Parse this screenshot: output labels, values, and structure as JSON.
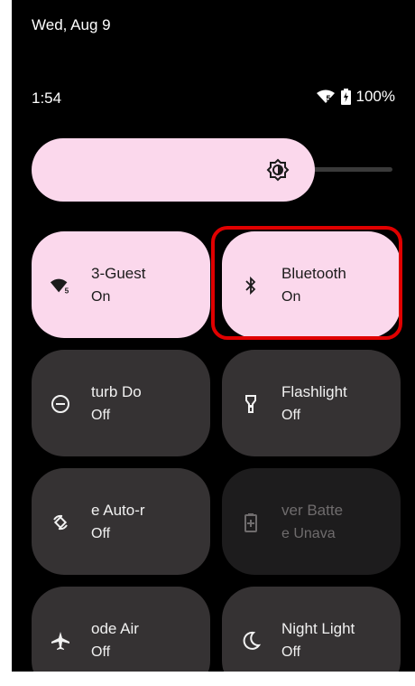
{
  "header": {
    "date": "Wed, Aug 9",
    "time": "1:54",
    "battery": "100%",
    "wifi_badge": "5"
  },
  "brightness": {
    "level": 0.82
  },
  "tiles": [
    {
      "label": "3-Guest",
      "status": "On",
      "icon": "wifi-icon",
      "state": "on"
    },
    {
      "label": "Bluetooth",
      "status": "On",
      "icon": "bluetooth-icon",
      "state": "on"
    },
    {
      "label": "turb Do",
      "status": "Off",
      "icon": "do-not-disturb-icon",
      "state": "off"
    },
    {
      "label": "Flashlight",
      "status": "Off",
      "icon": "flashlight-icon",
      "state": "off"
    },
    {
      "label": "e Auto-r",
      "status": "Off",
      "icon": "auto-rotate-icon",
      "state": "off"
    },
    {
      "label": "ver Batte",
      "status": "e Unava",
      "icon": "battery-saver-icon",
      "state": "unavailable"
    },
    {
      "label": "ode Air",
      "status": "Off",
      "icon": "airplane-icon",
      "state": "off"
    },
    {
      "label": "Night Light",
      "status": "Off",
      "icon": "night-light-icon",
      "state": "off"
    }
  ],
  "colors": {
    "tile_on": "#fbd8ec",
    "tile_off": "#353233",
    "tile_unavailable": "#1d1c1d",
    "highlight": "#e00000"
  }
}
